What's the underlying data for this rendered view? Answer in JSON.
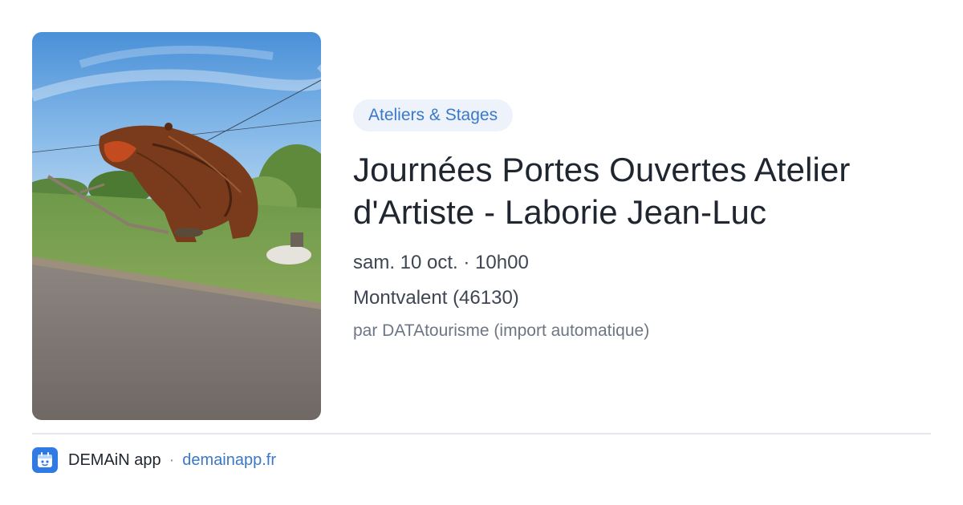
{
  "photo": {
    "icon": "bear-sculpture-photo"
  },
  "event": {
    "category": "Ateliers & Stages",
    "title": "Journées Portes Ouvertes Atelier d'Artiste - Laborie Jean-Luc",
    "datetime": "sam. 10 oct. · 10h00",
    "location": "Montvalent (46130)",
    "source": "par DATAtourisme (import automatique)"
  },
  "footer": {
    "logo_icon": "demain-app-logo-icon",
    "app_name": "DEMAiN app",
    "separator": "·",
    "link": "demainapp.fr"
  },
  "colors": {
    "accent": "#3a78c9",
    "tag_background": "#eef3fb",
    "title": "#1f2630",
    "logo": "#2f7be3"
  }
}
